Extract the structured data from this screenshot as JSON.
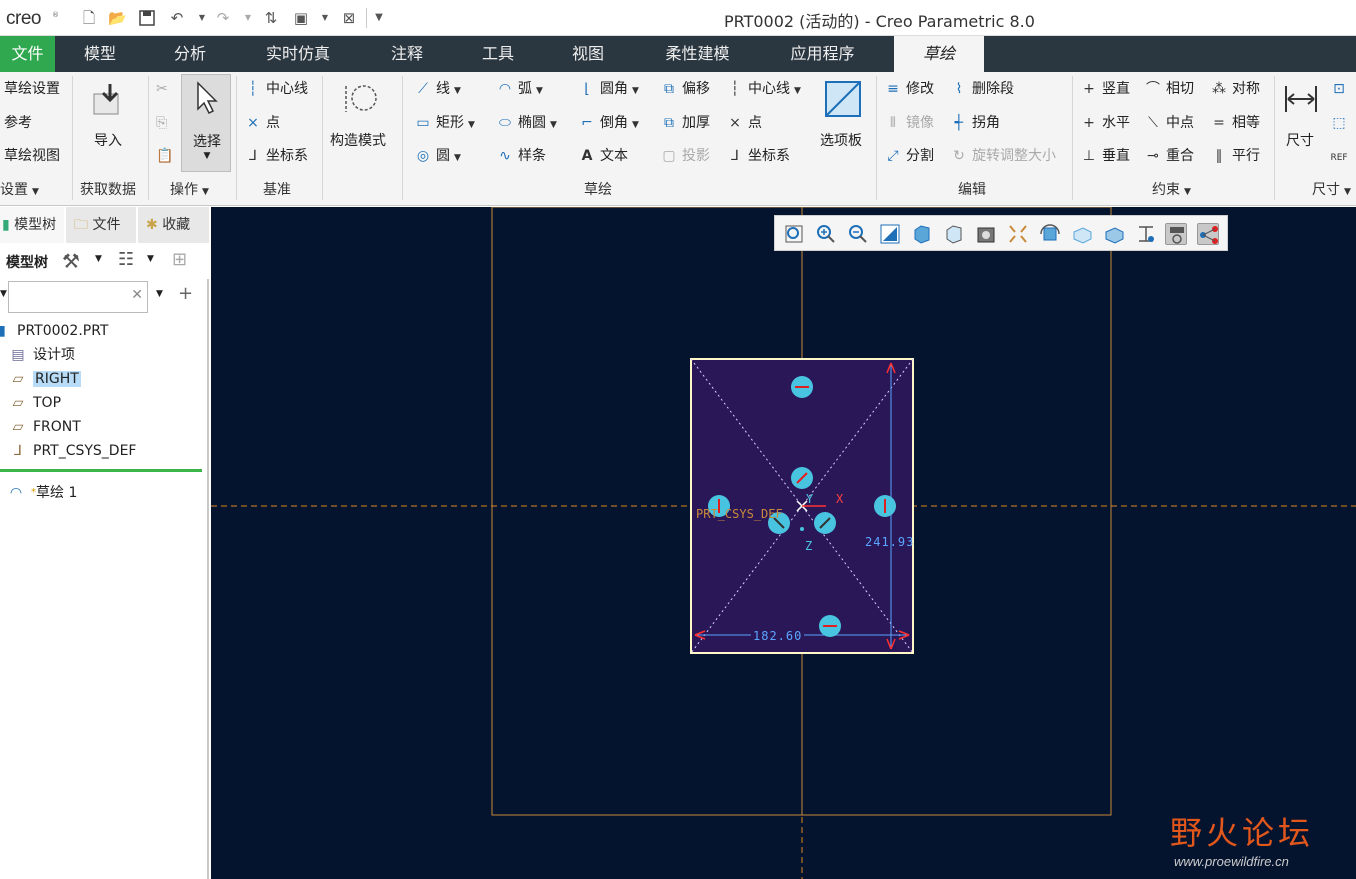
{
  "window": {
    "title": "PRT0002 (活动的) - Creo Parametric 8.0",
    "logo": "creo",
    "logo_mark": "®"
  },
  "quick_access": {
    "icons": [
      "new-icon",
      "open-icon",
      "save-icon",
      "undo-icon",
      "redo-icon",
      "regenerate-icon",
      "window-icon",
      "close-icon",
      "customize-icon"
    ]
  },
  "ribbon_tabs": [
    "文件",
    "模型",
    "分析",
    "实时仿真",
    "注释",
    "工具",
    "视图",
    "柔性建模",
    "应用程序",
    "草绘"
  ],
  "ribbon": {
    "setup": {
      "items": [
        "草绘设置",
        "参考",
        "草绘视图"
      ],
      "group": "设置"
    },
    "get_data": {
      "import": "导入",
      "group": "获取数据"
    },
    "operations": {
      "select": "选择",
      "group": "操作"
    },
    "datum": {
      "items": [
        "中心线",
        "点",
        "坐标系"
      ],
      "group": "基准"
    },
    "construction": {
      "label": "构造模式"
    },
    "sketching": {
      "col1": [
        "线",
        "矩形",
        "圆"
      ],
      "col2": [
        "弧",
        "椭圆",
        "样条"
      ],
      "col3": [
        "圆角",
        "倒角",
        "文本"
      ],
      "col4": [
        "偏移",
        "加厚",
        "投影"
      ],
      "col5": [
        "中心线",
        "点",
        "坐标系"
      ],
      "palette": "选项板",
      "group": "草绘"
    },
    "editing": {
      "col1": [
        "修改",
        "镜像",
        "分割"
      ],
      "col2": [
        "删除段",
        "拐角",
        "旋转调整大小"
      ],
      "group": "编辑"
    },
    "constrain": {
      "col1": [
        "竖直",
        "水平",
        "垂直"
      ],
      "col2": [
        "相切",
        "中点",
        "重合"
      ],
      "col3": [
        "对称",
        "相等",
        "平行"
      ],
      "group": "约束"
    },
    "dimension": {
      "label": "尺寸",
      "group": "尺寸"
    }
  },
  "left_panel": {
    "tabs": [
      "模型树",
      "文件",
      "收藏"
    ],
    "toolbar_label": "模型树",
    "search": {
      "value": "",
      "placeholder": ""
    },
    "tree": [
      {
        "label": "PRT0002.PRT",
        "icon": "part-icon"
      },
      {
        "label": "设计项",
        "icon": "design-item-icon"
      },
      {
        "label": "RIGHT",
        "icon": "datum-plane-icon",
        "selected": true
      },
      {
        "label": "TOP",
        "icon": "datum-plane-icon"
      },
      {
        "label": "FRONT",
        "icon": "datum-plane-icon"
      },
      {
        "label": "PRT_CSYS_DEF",
        "icon": "csys-icon"
      }
    ],
    "insert_item": {
      "label": "草绘 1",
      "icon": "sketch-icon"
    }
  },
  "canvas": {
    "csys_label": "PRT_CSYS_DEF",
    "axis_x": "X",
    "axis_y": "Y",
    "axis_z": "Z",
    "dim_width": "182.60",
    "dim_height": "241.93",
    "colors": {
      "background": "#04132e",
      "sketch_fill": "#2a1757",
      "datum_line": "#e08a1e",
      "sketch_line": "#fff7c8",
      "dimension": "#5aa6ff",
      "constraint": "#49c4e0"
    }
  },
  "view_toolbar": {
    "icons": [
      "refit-icon",
      "zoom-in-icon",
      "zoom-out-icon",
      "repaint-icon",
      "display-style-icon",
      "saved-orientations-icon",
      "view-manager-icon",
      "perspective-icon",
      "spin-center-icon",
      "named-views-icon",
      "model-display-icon",
      "annotation-display-icon",
      "sketch-orientation-icon",
      "sketcher-display-icon"
    ]
  },
  "watermark": {
    "text": "野火论坛",
    "url": "www.proewildfire.cn"
  }
}
